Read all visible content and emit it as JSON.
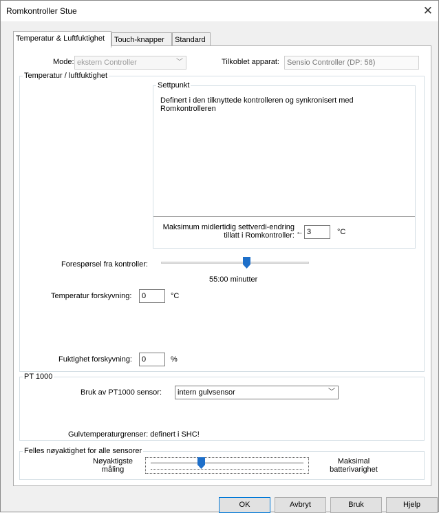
{
  "window": {
    "title": "Romkontroller Stue",
    "close_symbol": "✕"
  },
  "tabs": [
    {
      "label": "Temperatur & Luftfuktighet"
    },
    {
      "label": "Touch-knapper"
    },
    {
      "label": "Standard"
    }
  ],
  "mode": {
    "label": "Mode:",
    "value": "ekstern Controller"
  },
  "connected": {
    "label": "Tilkoblet apparat:",
    "value": "Sensio Controller  (DP: 58)"
  },
  "temp_group": {
    "label": "Temperatur / luftfuktighet"
  },
  "setpoint": {
    "label": "Settpunkt",
    "description": "Definert i den tilknyttede  kontrolleren og synkronisert med Romkontrolleren",
    "max_change_label_1": "Maksimum midlertidig settverdi-endring",
    "max_change_label_2": "tillatt i Romkontroller:",
    "max_change_arrow": "←",
    "max_change_value": "3",
    "max_change_unit": "°C"
  },
  "request": {
    "label": "Forespørsel fra kontroller:",
    "value_text": "55:00 minutter",
    "slider_fraction": 0.58
  },
  "temp_offset": {
    "label": "Temperatur forskyvning:",
    "value": "0",
    "unit": "°C"
  },
  "humidity_offset": {
    "label": "Fuktighet forskyvning:",
    "value": "0",
    "unit": "%"
  },
  "pt1000": {
    "label": "PT 1000",
    "sensor_label": "Bruk av PT1000 sensor:",
    "sensor_value": "intern gulvsensor",
    "floor_limits": "Gulvtemperaturgrenser: definert i SHC!"
  },
  "accuracy": {
    "label": "Felles nøyaktighet for alle sensorer",
    "left_label_1": "Nøyaktigste",
    "left_label_2": "måling",
    "right_label_1": "Maksimal",
    "right_label_2": "batterivarighet",
    "slider_fraction": 0.33
  },
  "buttons": {
    "ok": "OK",
    "cancel": "Avbryt",
    "apply": "Bruk",
    "help": "Hjelp"
  },
  "colors": {
    "accent": "#0078d7",
    "thumb": "#1e6fc9"
  }
}
